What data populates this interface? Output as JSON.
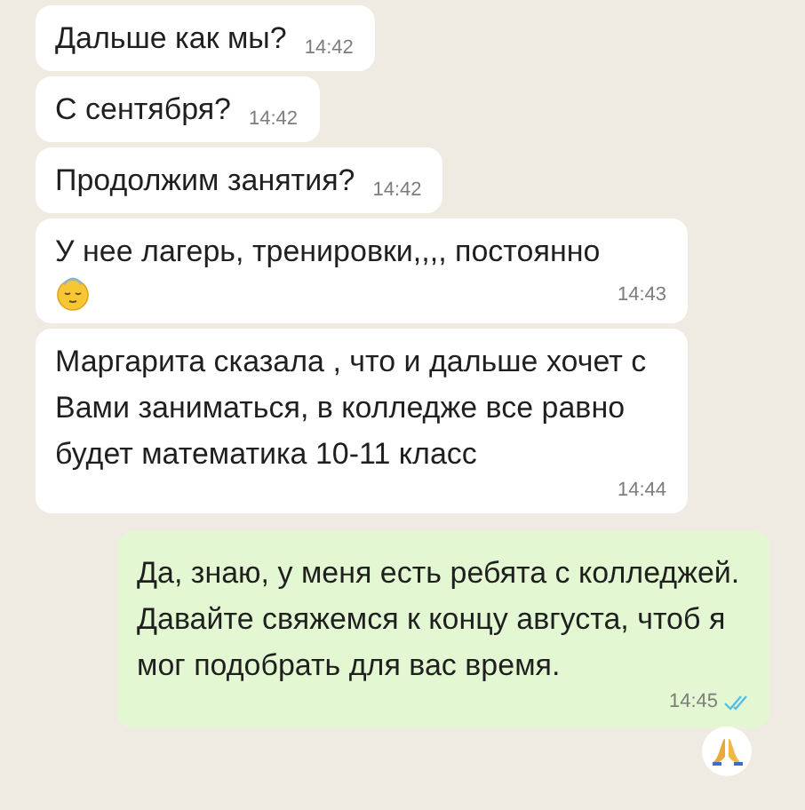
{
  "messages": [
    {
      "kind": "incoming",
      "text": "Дальше как мы?",
      "time": "14:42"
    },
    {
      "kind": "incoming",
      "text": "С сентября?",
      "time": "14:42"
    },
    {
      "kind": "incoming",
      "text": "Продолжим занятия?",
      "time": "14:42"
    },
    {
      "kind": "incoming",
      "text": "У нее лагерь, тренировки,,,, постоянно",
      "time": "14:43",
      "has_emoji": true
    },
    {
      "kind": "incoming",
      "text": "Маргарита сказала , что и дальше хочет с Вами заниматься, в колледже все равно будет математика 10-11 класс",
      "time": "14:44"
    },
    {
      "kind": "outgoing",
      "text": "Да, знаю, у меня есть ребята с колледжей. Давайте свяжемся к концу августа, чтоб я мог подобрать для вас время.",
      "time": "14:45",
      "read": true,
      "reacted": true
    }
  ]
}
